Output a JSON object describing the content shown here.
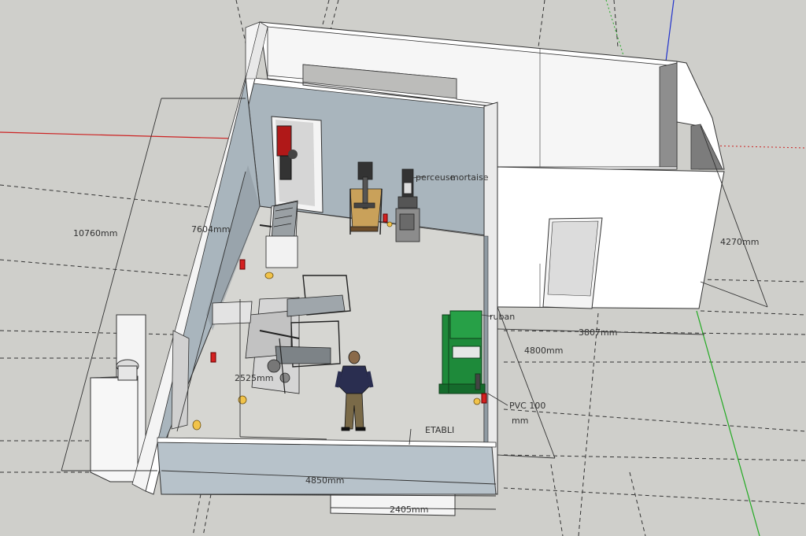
{
  "colors": {
    "ground": "#cfcfcb",
    "wall_top": "#ffffff",
    "wall_inner": "#a9b5bd",
    "wall_outer": "#eeeeee",
    "floor": "#d6d6d2",
    "axis_red": "#cc2222",
    "axis_green": "#22aa22",
    "axis_blue": "#2233cc",
    "bandsaw_green": "#1e8a3a"
  },
  "dimensions": {
    "overall_length": "10760mm",
    "interior_length": "7604mm",
    "right_depth": "4270mm",
    "right_width": "3807mm",
    "room_depth": "4800mm",
    "front_width": "4850mm",
    "door_width": "2405mm",
    "machine_spacing": "2525mm"
  },
  "labels": {
    "drill_press": "perceuse",
    "mortiser": "mortaise",
    "bandsaw": "ruban",
    "pvc_line1": "PVC 100",
    "pvc_line2": "mm",
    "workbench": "ETABLI"
  },
  "icons": [
    "person-figure",
    "fire-extinguisher-icon",
    "dust-bucket-icon"
  ]
}
